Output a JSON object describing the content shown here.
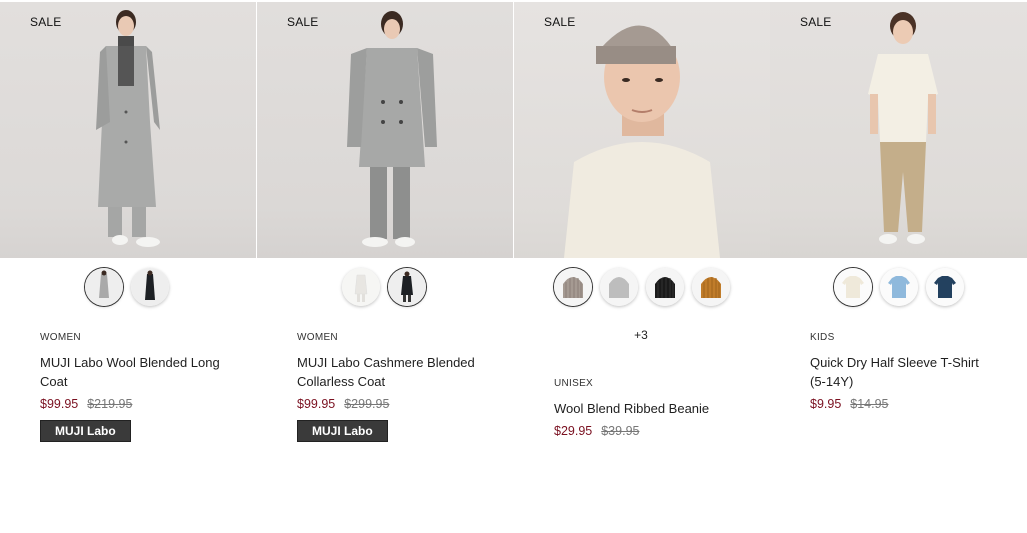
{
  "products": [
    {
      "sale": "SALE",
      "category": "WOMEN",
      "name": "MUJI Labo Wool Blended Long Coat",
      "price": "$99.95",
      "original_price": "$219.95",
      "badge": "MUJI Labo",
      "swatches": [
        "light-gray-coat-icon",
        "black-coat-icon"
      ],
      "more": ""
    },
    {
      "sale": "SALE",
      "category": "WOMEN",
      "name": "MUJI Labo Cashmere Blended Collarless Coat",
      "price": "$99.95",
      "original_price": "$299.95",
      "badge": "MUJI Labo",
      "swatches": [
        "white-coat-icon",
        "black-coat-icon"
      ],
      "more": ""
    },
    {
      "sale": "SALE",
      "category": "UNISEX",
      "name": "Wool Blend Ribbed Beanie",
      "price": "$29.95",
      "original_price": "$39.95",
      "badge": "",
      "swatches": [
        "beige-beanie-icon",
        "gray-beanie-icon",
        "black-beanie-icon",
        "mustard-beanie-icon"
      ],
      "more": "+3"
    },
    {
      "sale": "SALE",
      "category": "KIDS",
      "name": "Quick Dry Half Sleeve T-Shirt (5-14Y)",
      "price": "$9.95",
      "original_price": "$14.95",
      "badge": "",
      "swatches": [
        "off-white-tshirt-icon",
        "light-blue-tshirt-icon",
        "navy-tshirt-icon"
      ],
      "more": ""
    }
  ],
  "colors": {
    "sale_price": "#7a1020",
    "badge_bg": "#3a3a3a",
    "photo_bg": "#dedbd9"
  }
}
